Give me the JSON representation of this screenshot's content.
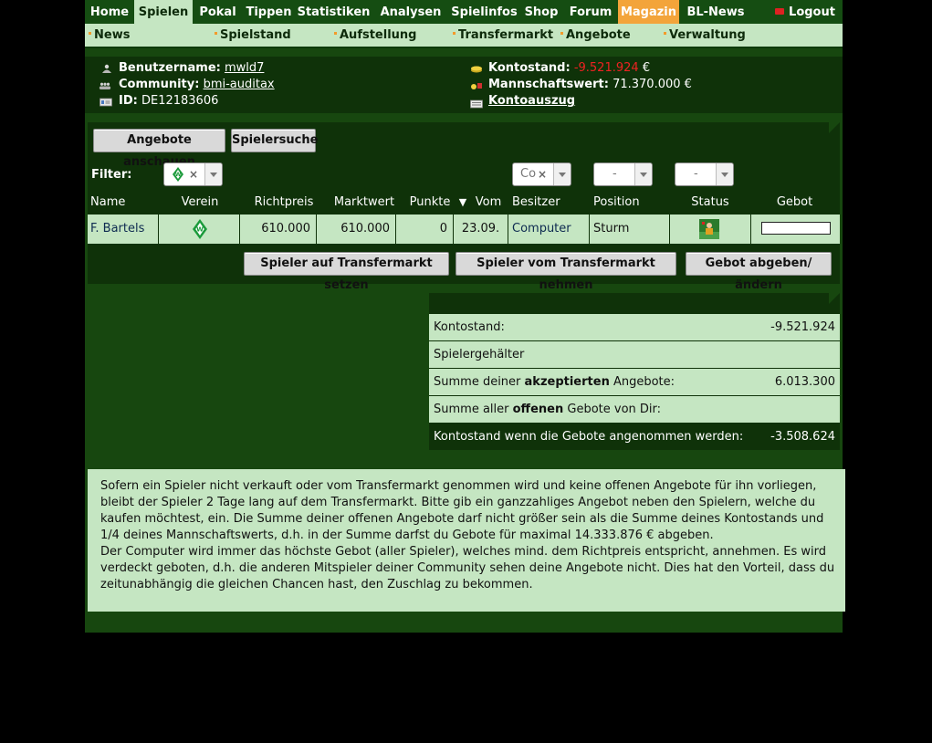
{
  "topnav": {
    "items": [
      {
        "label": "Home"
      },
      {
        "label": "Spielen"
      },
      {
        "label": "Pokal"
      },
      {
        "label": "Tippen"
      },
      {
        "label": "Statistiken"
      },
      {
        "label": "Analysen"
      },
      {
        "label": "Spielinfos"
      },
      {
        "label": "Shop"
      },
      {
        "label": "Forum"
      },
      {
        "label": "Magazin"
      },
      {
        "label": "BL-News"
      }
    ],
    "logout": "Logout"
  },
  "subnav": {
    "items": [
      {
        "label": "News"
      },
      {
        "label": "Spielstand"
      },
      {
        "label": "Aufstellung"
      },
      {
        "label": "Transfermarkt"
      },
      {
        "label": "Angebote"
      },
      {
        "label": "Verwaltung"
      }
    ]
  },
  "user": {
    "username_label": "Benutzername:",
    "username": "mwld7",
    "community_label": "Community:",
    "community": "bmi-auditax",
    "id_label": "ID:",
    "id": "DE12183606",
    "kontostand_label": "Kontostand:",
    "kontostand": "-9.521.924",
    "currency": "€",
    "mannschaftswert_label": "Mannschaftswert:",
    "mannschaftswert": "71.370.000 €",
    "kontoauszug": "Kontoauszug"
  },
  "colors": {
    "bg_dark": "#0f3209",
    "bg_green": "#17470f",
    "light_green": "#c5e6c2",
    "accent_orange": "#f3a43a",
    "negative_red": "#e22222"
  },
  "transfer": {
    "btn_angebote": "Angebote anschauen",
    "btn_spielersuche": "Spielersuche",
    "filter_label": "Filter:",
    "filter_besitzer": "Co",
    "filter_position": "-",
    "filter_status": "-",
    "headers": {
      "name": "Name",
      "verein": "Verein",
      "richtpreis": "Richtpreis",
      "marktwert": "Marktwert",
      "punkte": "Punkte",
      "sort_icon": "▼",
      "vom": "Vom",
      "besitzer": "Besitzer",
      "position": "Position",
      "status": "Status",
      "gebot": "Gebot"
    },
    "rows": [
      {
        "name": "F. Bartels",
        "verein_icon": "werder-bremen-logo-icon",
        "richtpreis": "610.000",
        "marktwert": "610.000",
        "punkte": "0",
        "vom": "23.09.",
        "besitzer": "Computer",
        "position": "Sturm",
        "status_icon": "player-status-icon",
        "gebot": ""
      }
    ],
    "btn_setzen": "Spieler auf Transfermarkt setzen",
    "btn_nehmen": "Spieler vom Transfermarkt nehmen",
    "btn_gebot": "Gebot abgeben/ändern"
  },
  "summary": {
    "kontostand_label": "Kontostand:",
    "kontostand": "-9.521.924",
    "gehaelter_label": "Spielergehälter",
    "akzeptiert_pre": "Summe deiner ",
    "akzeptiert_bold": "akzeptierten",
    "akzeptiert_post": " Angebote:",
    "akzeptiert_value": "6.013.300",
    "offen_pre": "Summe aller ",
    "offen_bold": "offenen",
    "offen_post": " Gebote von Dir:",
    "final_label": "Kontostand wenn die Gebote angenommen werden:",
    "final_value": "-3.508.624"
  },
  "info_text": {
    "p1": "Sofern ein Spieler nicht verkauft oder vom Transfermarkt genommen wird und keine offenen Angebote für ihn vorliegen, bleibt der Spieler 2 Tage lang auf dem Transfermarkt. Bitte gib ein ganzzahliges Angebot neben den Spielern, welche du kaufen möchtest, ein. Die Summe deiner offenen Angebote darf nicht größer sein als die Summe deines Kontostands und 1/4 deines Mannschaftswerts, d.h. in der Summe darfst du Gebote für maximal 14.333.876 € abgeben.",
    "p2": "Der Computer wird immer das höchste Gebot (aller Spieler), welches mind. dem Richtpreis entspricht, annehmen. Es wird verdeckt geboten, d.h. die anderen Mitspieler deiner Community sehen deine Angebote nicht. Dies hat den Vorteil, dass du zeitunabhängig die gleichen Chancen hast, den Zuschlag zu bekommen."
  }
}
